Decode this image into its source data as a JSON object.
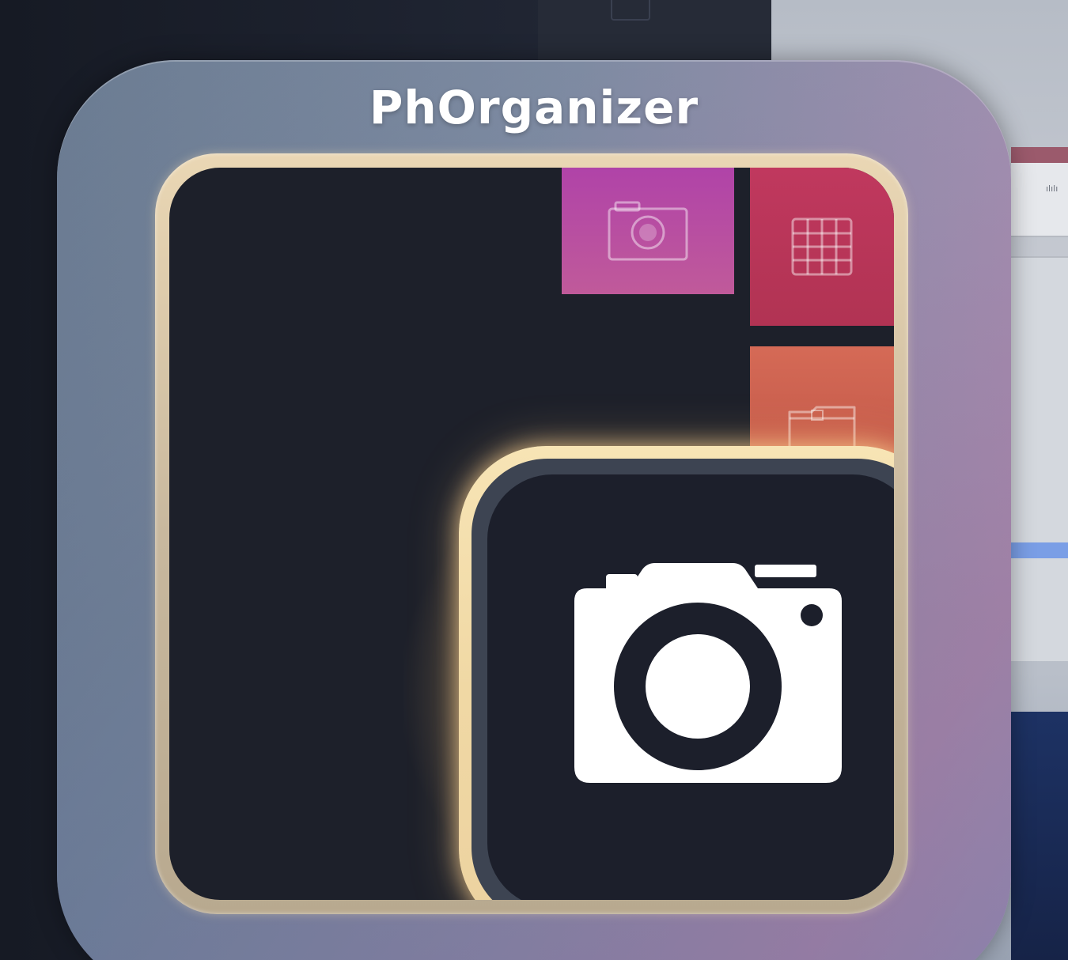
{
  "app": {
    "title": "PhOrganizer"
  },
  "background": {
    "window_fragment_text": "ılılı"
  },
  "colors": {
    "tile_frame": "#7e8ba2",
    "gold_frame": "#ead7b4",
    "screen_bg": "#1d202a",
    "center_icon": "#ffffff",
    "tiles": [
      "#b043a8",
      "#c0385e",
      "#d56a56",
      "#2a9a8a",
      "#b5b24a",
      "#2f89c5"
    ]
  },
  "tiles": [
    {
      "name": "photo-album-tile",
      "icon": "photo-album-icon"
    },
    {
      "name": "grid-tile",
      "icon": "grid-icon"
    },
    {
      "name": "folder-tile",
      "icon": "folder-icon"
    },
    {
      "name": "gallery-tile",
      "icon": "gallery-icon"
    },
    {
      "name": "document-tile",
      "icon": "document-icon"
    },
    {
      "name": "camera-tile",
      "icon": "camera-icon"
    }
  ],
  "center_icon": "camera-icon"
}
